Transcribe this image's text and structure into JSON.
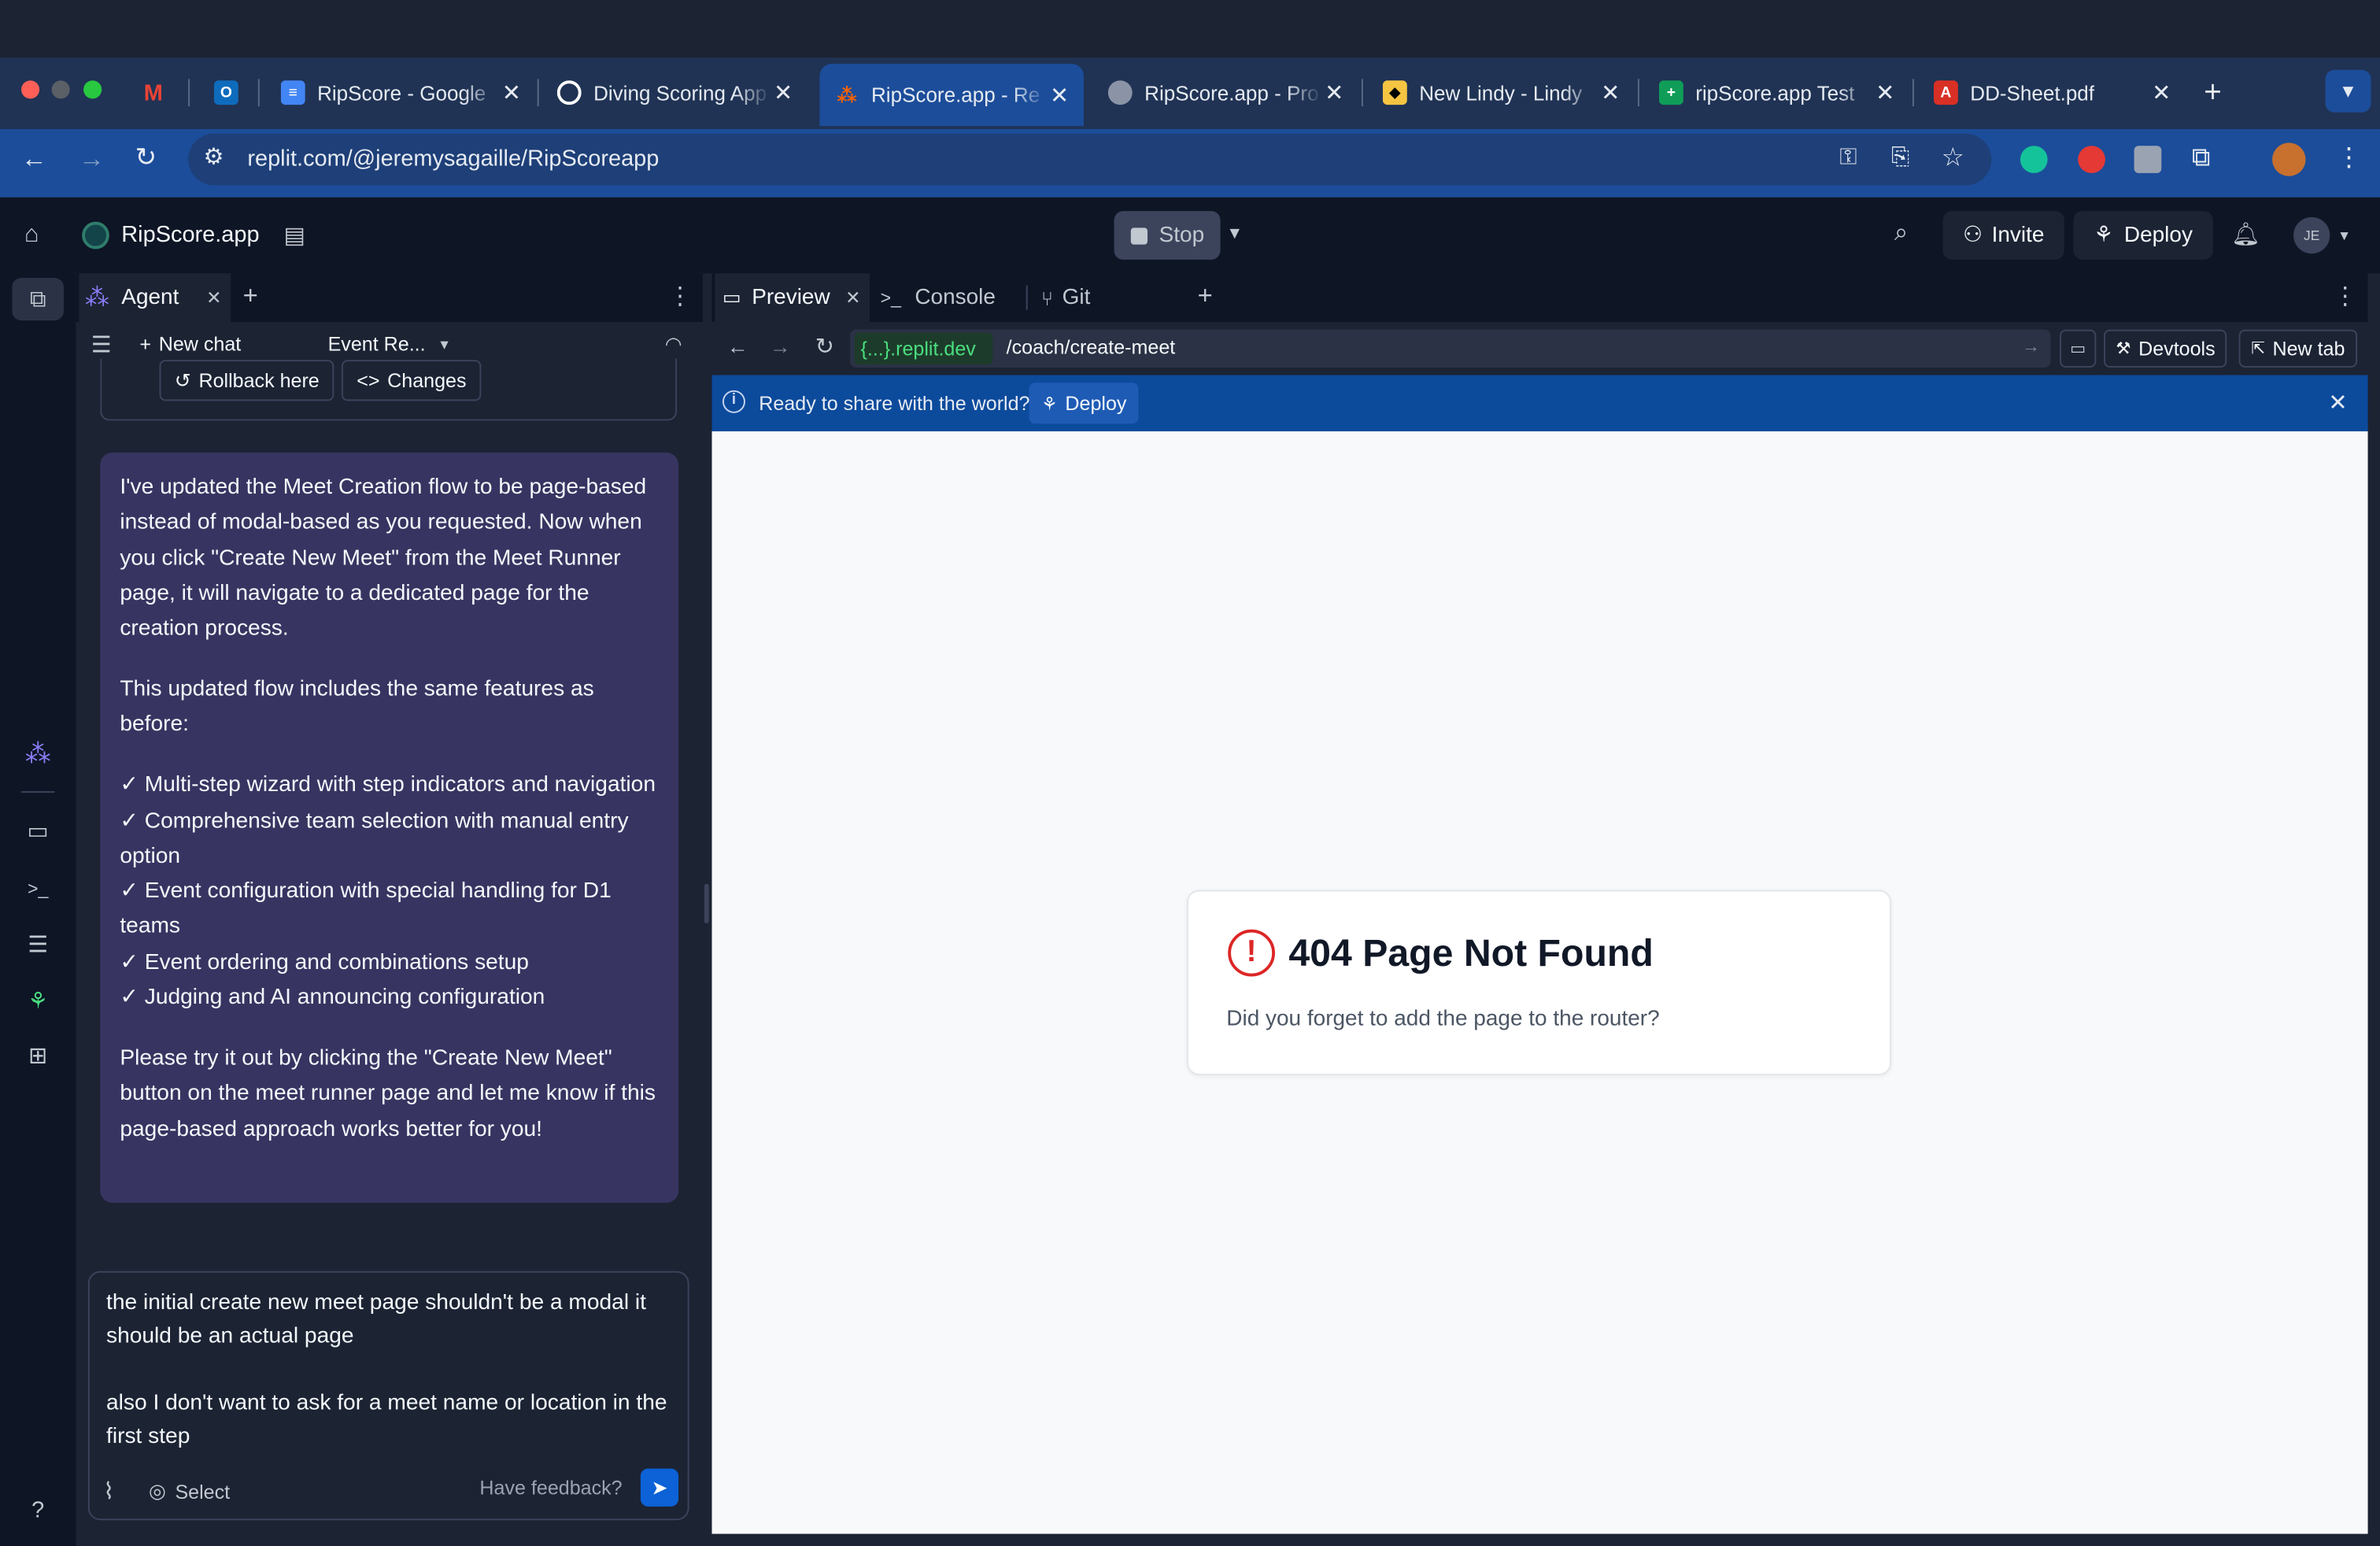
{
  "browser": {
    "tabs": [
      {
        "title": "",
        "icon": "gmail-icon",
        "color": "#ea4335"
      },
      {
        "title": "",
        "icon": "outlook-icon",
        "color": "#0f6cbd"
      },
      {
        "title": "RipScore - Google",
        "icon": "docs-icon",
        "color": "#4285f4"
      },
      {
        "title": "Diving Scoring App",
        "icon": "chatgpt-icon",
        "color": "#ffffff"
      },
      {
        "title": "RipScore.app - Re",
        "icon": "replit-icon",
        "color": "#f26207",
        "active": true
      },
      {
        "title": "RipScore.app - Pro",
        "icon": "globe-icon",
        "color": "#c2c8d0"
      },
      {
        "title": "New Lindy - Lindy",
        "icon": "lindy-icon",
        "color": "#f5c542"
      },
      {
        "title": "ripScore.app Test",
        "icon": "sheets-icon",
        "color": "#0f9d58"
      },
      {
        "title": "DD-Sheet.pdf",
        "icon": "pdf-icon",
        "color": "#d93025"
      }
    ],
    "new_tab_label": "+",
    "url": "replit.com/@jeremysagaille/RipScoreapp"
  },
  "replit": {
    "project_name": "RipScore.app",
    "stop_label": "Stop",
    "invite_label": "Invite",
    "deploy_label": "Deploy",
    "avatar_initials": "JE"
  },
  "agent": {
    "tab_label": "Agent",
    "new_chat_label": "New chat",
    "thread_name": "Event Re...",
    "rollback_label": "Rollback here",
    "changes_label": "Changes",
    "message": {
      "p1": "I've updated the Meet Creation flow to be page-based instead of modal-based as you requested. Now when you click \"Create New Meet\" from the Meet Runner page, it will navigate to a dedicated page for the creation process.",
      "p2": "This updated flow includes the same features as before:",
      "items": [
        "✓ Multi-step wizard with step indicators and navigation",
        "✓ Comprehensive team selection with manual entry option",
        "✓ Event configuration with special handling for D1 teams",
        "✓ Event ordering and combinations setup",
        "✓ Judging and AI announcing configuration"
      ],
      "p3": "Please try it out by clicking the \"Create New Meet\" button on the meet runner page and let me know if this page-based approach works better for you!"
    },
    "composer": {
      "line1": "the initial create new meet page shouldn't be a modal it should be an actual page",
      "line2": "also I don't want to ask for a meet name or location in the first step",
      "select_label": "Select",
      "feedback_label": "Have feedback?"
    }
  },
  "preview": {
    "tabs": {
      "preview": "Preview",
      "console": "Console",
      "git": "Git"
    },
    "domain": "{...}.replit.dev",
    "path": "/coach/create-meet",
    "devtools_label": "Devtools",
    "new_tab_label": "New tab",
    "banner_text": "Ready to share with the world?",
    "banner_deploy": "Deploy",
    "error_title": "404 Page Not Found",
    "error_body": "Did you forget to add the page to the router?"
  },
  "colors": {
    "tab_strip": "#203354",
    "toolbar": "#1c4d9a",
    "replit_bg": "#0e1525",
    "agent_bubble": "#383461",
    "error_red": "#dc2626",
    "domain_green": "#4ade80"
  }
}
